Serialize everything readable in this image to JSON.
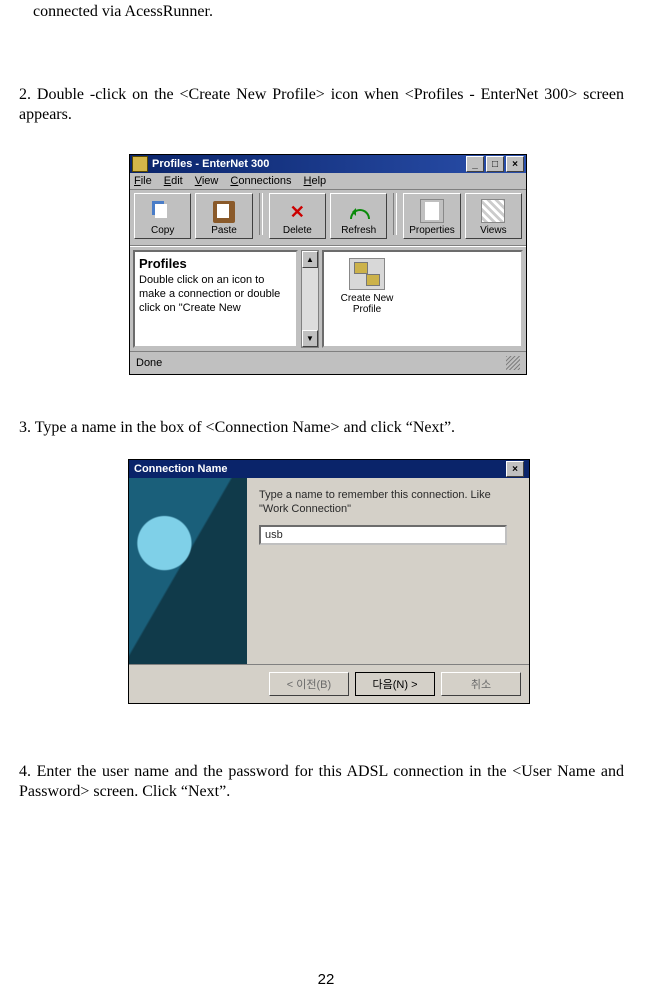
{
  "para1": "connected via AcessRunner.",
  "para2": "2. Double -click on the <Create New Profile>  icon   when   <Profiles -  EnterNet 300> screen appears.",
  "para3": "3. Type a name in the box  of <Connection Name>  and click “Next”.",
  "para4": "4. Enter the user name and the password   for this ADSL connection in the <User Name and Password> screen. Click “Next”.",
  "page_number": "22",
  "win1": {
    "title": "Profiles - EnterNet 300",
    "menu": {
      "file": "File",
      "edit": "Edit",
      "view": "View",
      "connections": "Connections",
      "help": "Help"
    },
    "toolbar": {
      "copy": "Copy",
      "paste": "Paste",
      "delete": "Delete",
      "refresh": "Refresh",
      "properties": "Properties",
      "views": "Views"
    },
    "left_title": "Profiles",
    "left_text": "Double click on an icon to make a connection or double click on \"Create New",
    "icon_label_l1": "Create New",
    "icon_label_l2": "Profile",
    "status": "Done"
  },
  "win2": {
    "title": "Connection Name",
    "instr": "Type a name to remember this connection.  Like \"Work Connection\"",
    "value": "usb",
    "btn_back": "< 이전(B)",
    "btn_next": "다음(N) >",
    "btn_cancel": "취소"
  }
}
